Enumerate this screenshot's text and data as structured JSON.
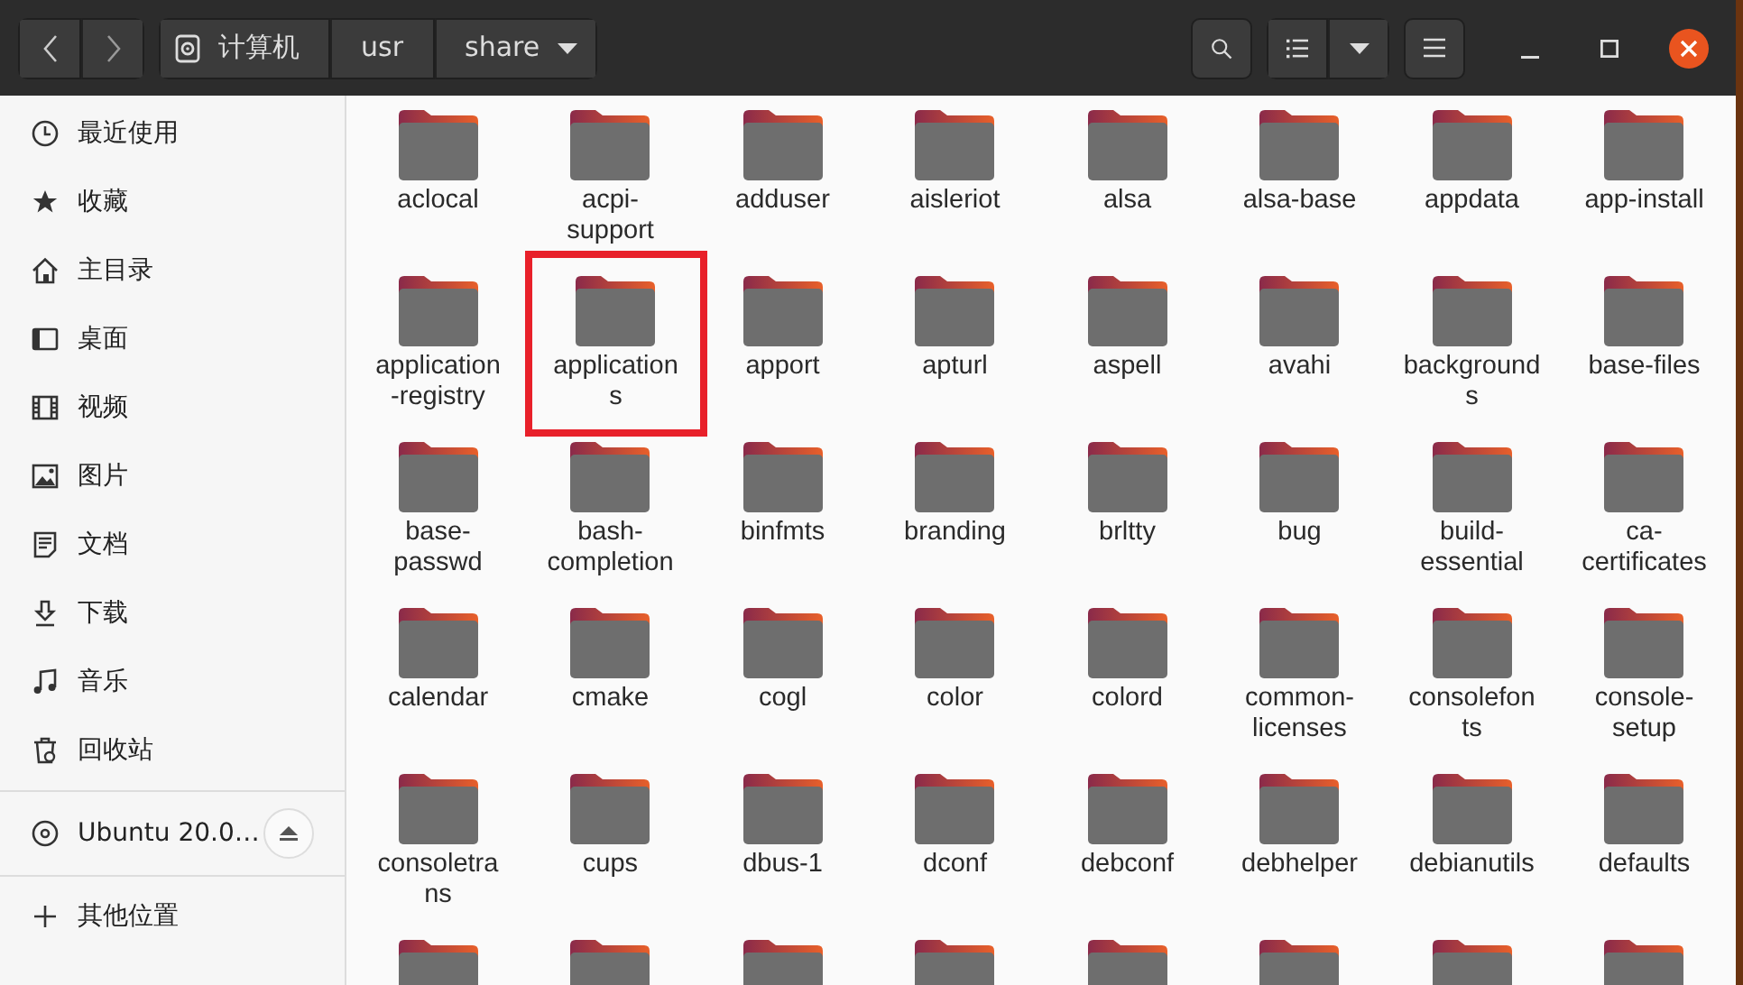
{
  "header": {
    "path": [
      {
        "label": "计算机",
        "kind": "device"
      },
      {
        "label": "usr",
        "kind": "plain"
      },
      {
        "label": "share",
        "kind": "current"
      }
    ]
  },
  "sidebar": {
    "places": [
      "最近使用",
      "收藏",
      "主目录",
      "桌面",
      "视频",
      "图片",
      "文档",
      "下载",
      "音乐",
      "回收站"
    ],
    "devices": [
      {
        "label": "Ubuntu 20.0…"
      }
    ],
    "other": [
      "其他位置"
    ]
  },
  "folders": [
    {
      "lines": [
        "aclocal"
      ],
      "highlighted": false
    },
    {
      "lines": [
        "acpi-",
        "support"
      ],
      "highlighted": false
    },
    {
      "lines": [
        "adduser"
      ],
      "highlighted": false
    },
    {
      "lines": [
        "aisleriot"
      ],
      "highlighted": false
    },
    {
      "lines": [
        "alsa"
      ],
      "highlighted": false
    },
    {
      "lines": [
        "alsa-base"
      ],
      "highlighted": false
    },
    {
      "lines": [
        "appdata"
      ],
      "highlighted": false
    },
    {
      "lines": [
        "app-install"
      ],
      "highlighted": false
    },
    {
      "lines": [
        "application",
        "-registry"
      ],
      "highlighted": false
    },
    {
      "lines": [
        "application",
        "s"
      ],
      "highlighted": true
    },
    {
      "lines": [
        "apport"
      ],
      "highlighted": false
    },
    {
      "lines": [
        "apturl"
      ],
      "highlighted": false
    },
    {
      "lines": [
        "aspell"
      ],
      "highlighted": false
    },
    {
      "lines": [
        "avahi"
      ],
      "highlighted": false
    },
    {
      "lines": [
        "background",
        "s"
      ],
      "highlighted": false
    },
    {
      "lines": [
        "base-files"
      ],
      "highlighted": false
    },
    {
      "lines": [
        "base-",
        "passwd"
      ],
      "highlighted": false
    },
    {
      "lines": [
        "bash-",
        "completion"
      ],
      "highlighted": false
    },
    {
      "lines": [
        "binfmts"
      ],
      "highlighted": false
    },
    {
      "lines": [
        "branding"
      ],
      "highlighted": false
    },
    {
      "lines": [
        "brltty"
      ],
      "highlighted": false
    },
    {
      "lines": [
        "bug"
      ],
      "highlighted": false
    },
    {
      "lines": [
        "build-",
        "essential"
      ],
      "highlighted": false
    },
    {
      "lines": [
        "ca-",
        "certificates"
      ],
      "highlighted": false
    },
    {
      "lines": [
        "calendar"
      ],
      "highlighted": false
    },
    {
      "lines": [
        "cmake"
      ],
      "highlighted": false
    },
    {
      "lines": [
        "cogl"
      ],
      "highlighted": false
    },
    {
      "lines": [
        "color"
      ],
      "highlighted": false
    },
    {
      "lines": [
        "colord"
      ],
      "highlighted": false
    },
    {
      "lines": [
        "common-",
        "licenses"
      ],
      "highlighted": false
    },
    {
      "lines": [
        "consolefon",
        "ts"
      ],
      "highlighted": false
    },
    {
      "lines": [
        "console-",
        "setup"
      ],
      "highlighted": false
    },
    {
      "lines": [
        "consoletra",
        "ns"
      ],
      "highlighted": false
    },
    {
      "lines": [
        "cups"
      ],
      "highlighted": false
    },
    {
      "lines": [
        "dbus-1"
      ],
      "highlighted": false
    },
    {
      "lines": [
        "dconf"
      ],
      "highlighted": false
    },
    {
      "lines": [
        "debconf"
      ],
      "highlighted": false
    },
    {
      "lines": [
        "debhelper"
      ],
      "highlighted": false
    },
    {
      "lines": [
        "debianutils"
      ],
      "highlighted": false
    },
    {
      "lines": [
        "defaults"
      ],
      "highlighted": false
    },
    {
      "highlighted": false
    },
    {
      "highlighted": false
    },
    {
      "highlighted": false
    },
    {
      "highlighted": false
    },
    {
      "highlighted": false
    },
    {
      "highlighted": false
    },
    {
      "highlighted": false
    },
    {
      "highlighted": false
    }
  ]
}
